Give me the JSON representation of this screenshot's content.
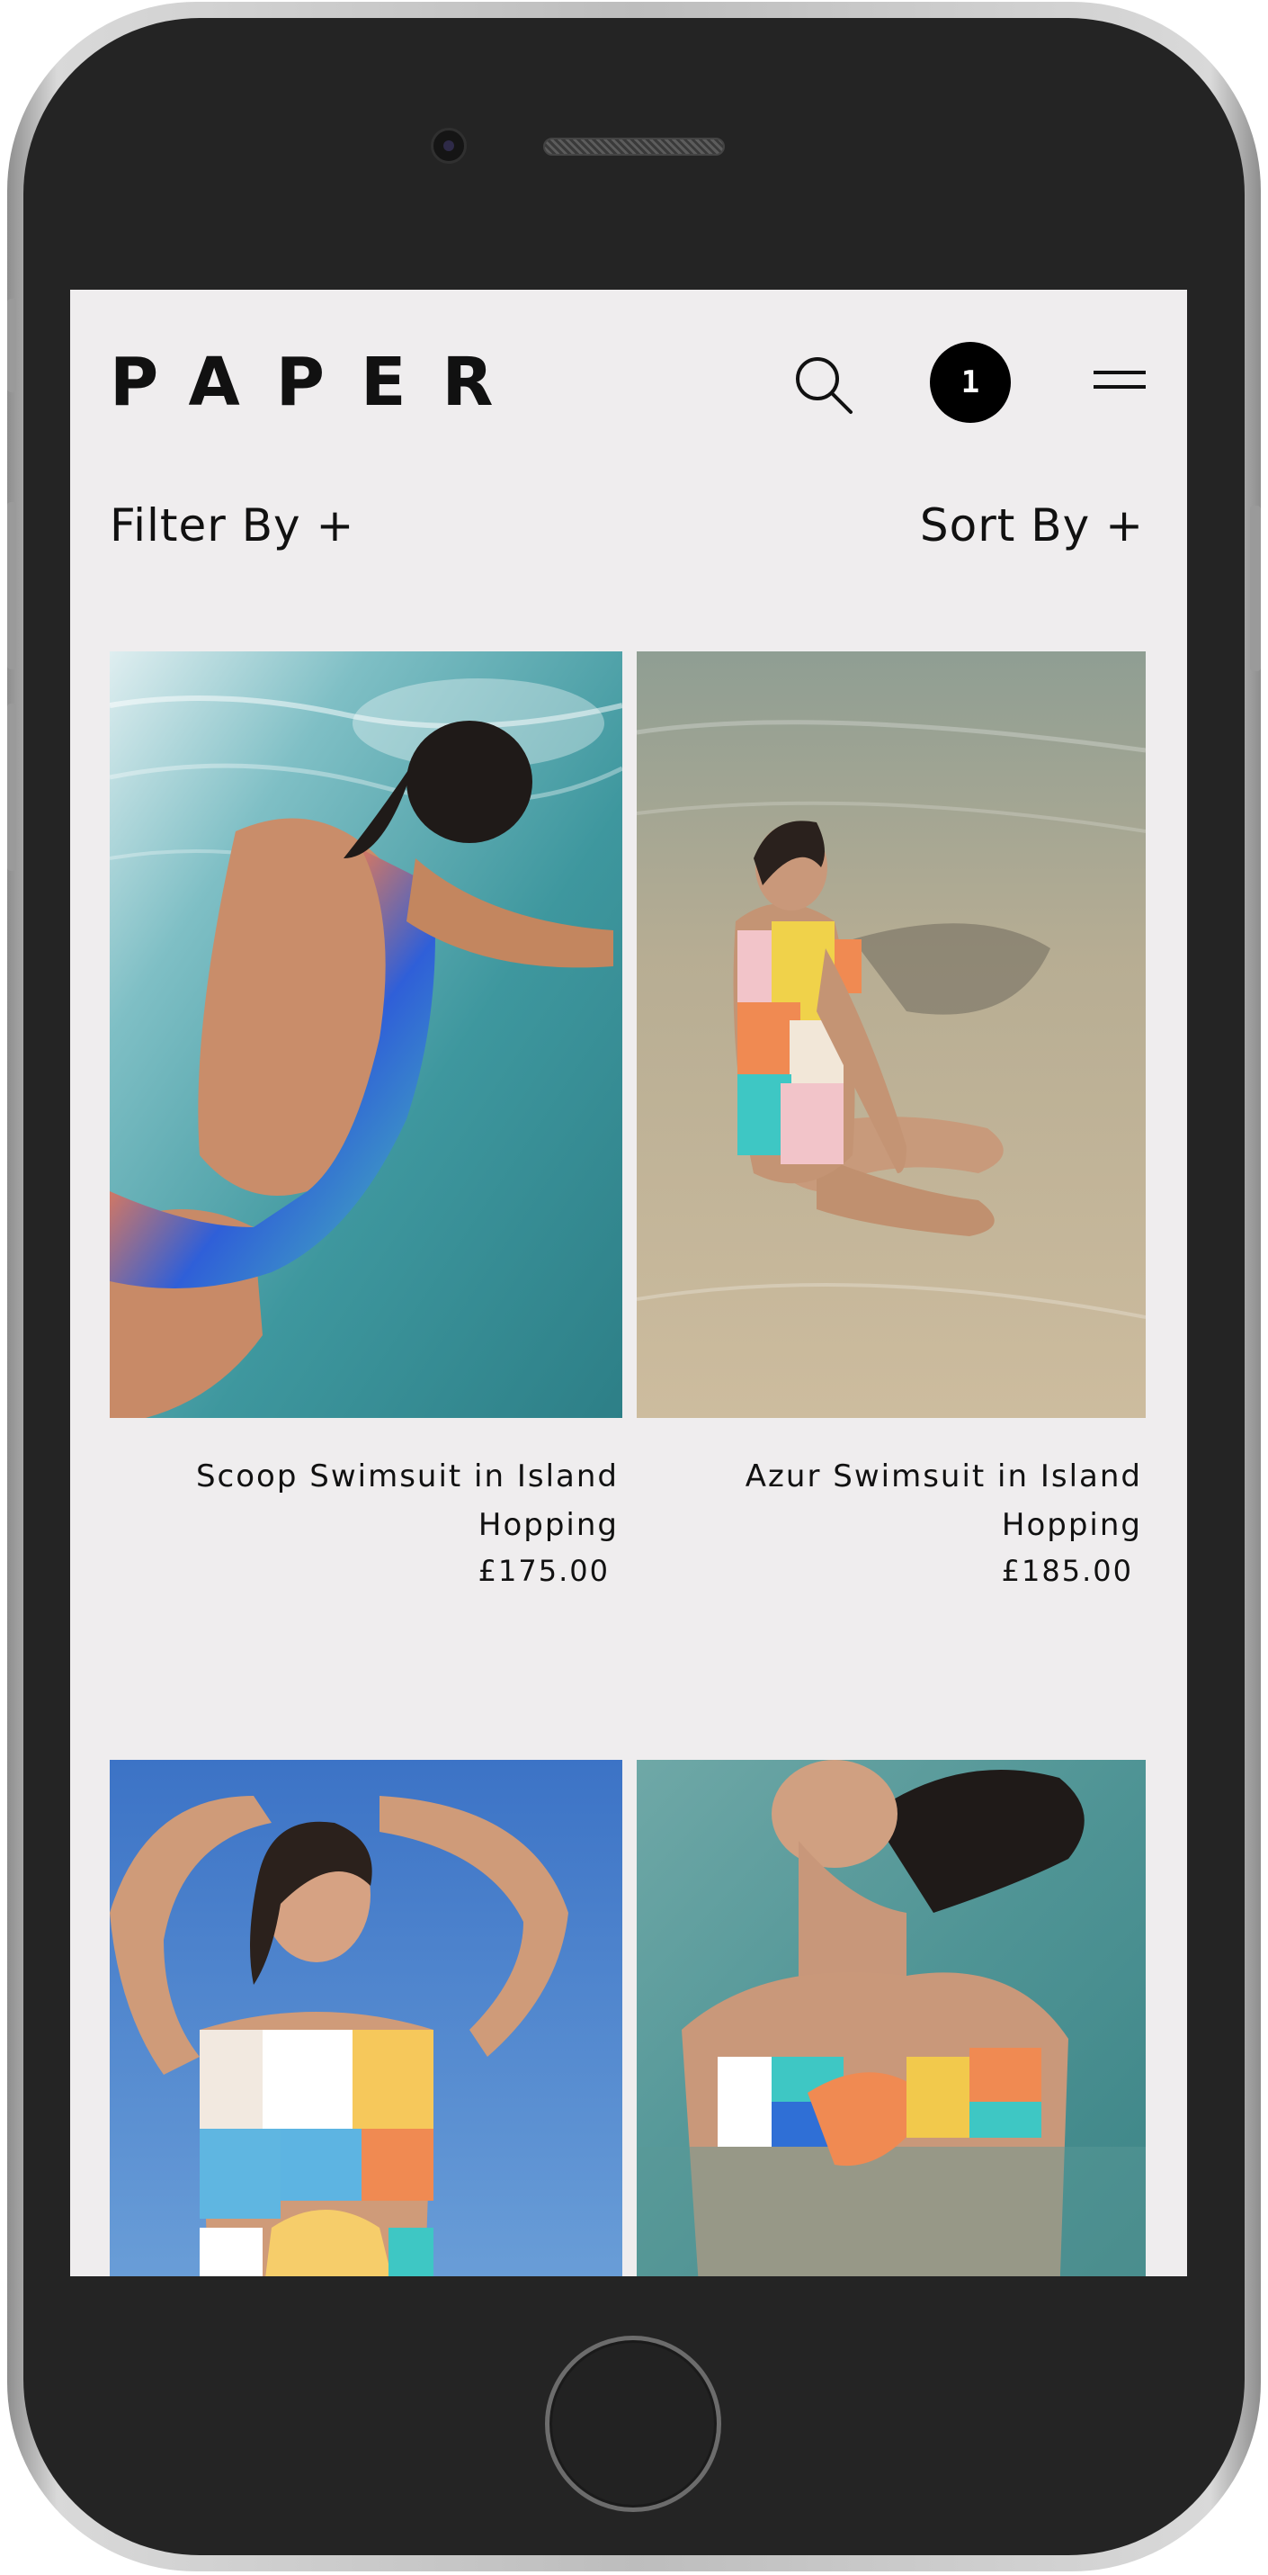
{
  "brand": {
    "logo": "PAPER"
  },
  "header": {
    "cart_count": "1"
  },
  "toolbar": {
    "filter_label": "Filter By +",
    "sort_label": "Sort By +"
  },
  "products": [
    {
      "name": "Scoop Swimsuit in Island Hopping",
      "price": "£175.00",
      "image": "woman-lying-in-turquoise-water-backless-swimsuit"
    },
    {
      "name": "Azur Swimsuit in Island Hopping",
      "price": "£185.00",
      "image": "woman-sitting-in-shallow-sea-swimsuit"
    },
    {
      "name": "",
      "price": "",
      "image": "woman-arms-raised-blue-sky-cutout-swimsuit"
    },
    {
      "name": "",
      "price": "",
      "image": "woman-floating-in-water-bandeau-bikini"
    }
  ],
  "colors": {
    "screen_bg": "#efedee",
    "text": "#111111",
    "badge_bg": "#000000",
    "device_body": "#242424"
  },
  "icons": [
    "search-icon",
    "hamburger-menu-icon"
  ]
}
